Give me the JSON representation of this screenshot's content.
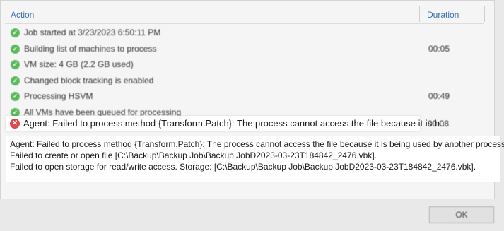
{
  "table": {
    "header_action": "Action",
    "header_duration": "Duration",
    "rows": [
      {
        "text": "Job started at 3/23/2023 6:50:11 PM",
        "duration": ""
      },
      {
        "text": "Building list of machines to process",
        "duration": "00:05"
      },
      {
        "text": "VM size: 4 GB (2.2 GB used)",
        "duration": ""
      },
      {
        "text": "Changed block tracking is enabled",
        "duration": ""
      },
      {
        "text": "Processing HSVM",
        "duration": "00:49"
      },
      {
        "text": "All VMs have been queued for processing",
        "duration": ""
      }
    ],
    "error_row": {
      "text": "Agent: Failed to process method {Transform.Patch}: The process cannot access the file because it is b...",
      "duration": "00:08"
    }
  },
  "tooltip": {
    "line1": "Agent: Failed to process method {Transform.Patch}: The process cannot access the file because it is being used by another process.",
    "line2": "Failed to create or open file [C:\\Backup\\Backup Job\\Backup JobD2023-03-23T184842_2476.vbk].",
    "line3": "Failed to open storage for read/write access. Storage: [C:\\Backup\\Backup Job\\Backup JobD2023-03-23T184842_2476.vbk]."
  },
  "footer": {
    "ok_label": "OK"
  },
  "icons": {
    "success": "check-circle-icon",
    "error": "error-circle-icon"
  },
  "colors": {
    "success": "#5cb85c",
    "error": "#e0474c",
    "header_text": "#3a6fb0"
  }
}
